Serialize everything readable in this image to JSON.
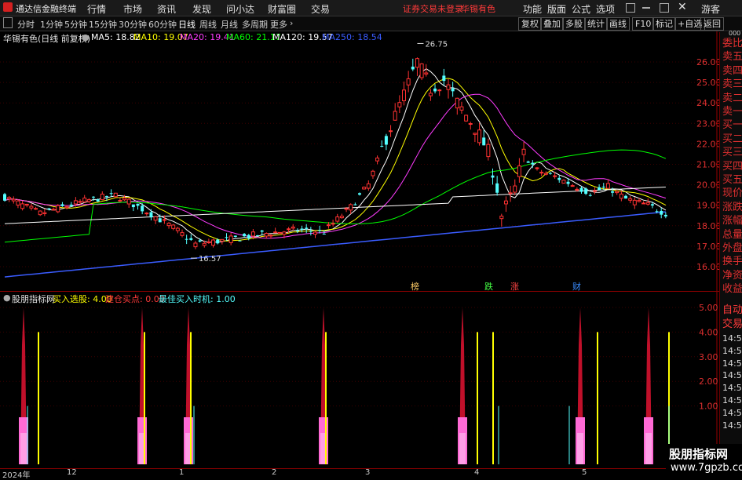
{
  "menubar": {
    "app_name": "通达信金融终端",
    "menus": [
      "行情",
      "市场",
      "资讯",
      "发现",
      "问小达",
      "财富圈",
      "交易"
    ],
    "warning": "证券交易未登录",
    "stock": "华锡有色",
    "right_menus": [
      "功能",
      "版面",
      "公式",
      "选项"
    ],
    "guest": "游客"
  },
  "periodbar": {
    "periods": [
      "分时",
      "1分钟",
      "5分钟",
      "15分钟",
      "30分钟",
      "60分钟",
      "日线",
      "周线",
      "月线",
      "多周期",
      "更多"
    ],
    "active": "日线",
    "tools": [
      "复权",
      "叠加",
      "多股",
      "统计",
      "画线",
      "F10",
      "标记",
      "+自选",
      "返回"
    ]
  },
  "chart_header": {
    "title": "华锡有色(日线 前复权)",
    "ma": [
      {
        "label": "MA5: 18.82",
        "color": "#ffffff"
      },
      {
        "label": "MA10: 19.07",
        "color": "#ffff00"
      },
      {
        "label": "MA20: 19.41",
        "color": "#ff3cff"
      },
      {
        "label": "MA60: 21.17",
        "color": "#00ff00"
      },
      {
        "label": "MA120: 19.57",
        "color": "#ffffff"
      },
      {
        "label": "MA250: 18.54",
        "color": "#3a5cff"
      }
    ]
  },
  "price_axis": {
    "ticks": [
      "26.00",
      "25.00",
      "24.00",
      "23.00",
      "22.00",
      "21.00",
      "20.00",
      "19.00",
      "18.00",
      "17.00",
      "16.00"
    ]
  },
  "price_annotations": {
    "high": "26.75",
    "low": "16.57"
  },
  "event_markers": [
    "榜",
    "跌",
    "涨",
    "财"
  ],
  "right_panel": {
    "items": [
      "委比",
      "卖五",
      "卖四",
      "卖三",
      "卖二",
      "卖一",
      "买一",
      "买二",
      "买三",
      "买四",
      "买五",
      "现价",
      "涨跌",
      "涨幅",
      "总量",
      "外盘",
      "换手",
      "净资",
      "收益"
    ],
    "small_label": "000",
    "trade_items": [
      "自动",
      "交易"
    ],
    "times": [
      "14:56",
      "14:56",
      "14:56",
      "14:56",
      "14:56",
      "14:56",
      "14:56",
      "14:56"
    ]
  },
  "indicator": {
    "name": "股朋指标网",
    "buy_select": "买入选股: 4.00",
    "build_point": "建仓买点: 0.00",
    "best_time": "最佳买入时机: 1.00",
    "axis_ticks": [
      "5.00",
      "4.00",
      "3.00",
      "2.00",
      "1.00"
    ]
  },
  "date_axis": {
    "labels": [
      "2024年",
      "12",
      "1",
      "2",
      "3",
      "4",
      "5"
    ]
  },
  "watermark": {
    "line1": "股朋指标网",
    "line2": "www.7gpzb.com"
  },
  "colors": {
    "up": "#ff3232",
    "down": "#54ffff",
    "ma5": "#ffffff",
    "ma10": "#ffff00",
    "ma20": "#ff3cff",
    "ma60": "#00ff00",
    "ma120": "#ffffff",
    "ma250": "#3a5cff"
  }
}
